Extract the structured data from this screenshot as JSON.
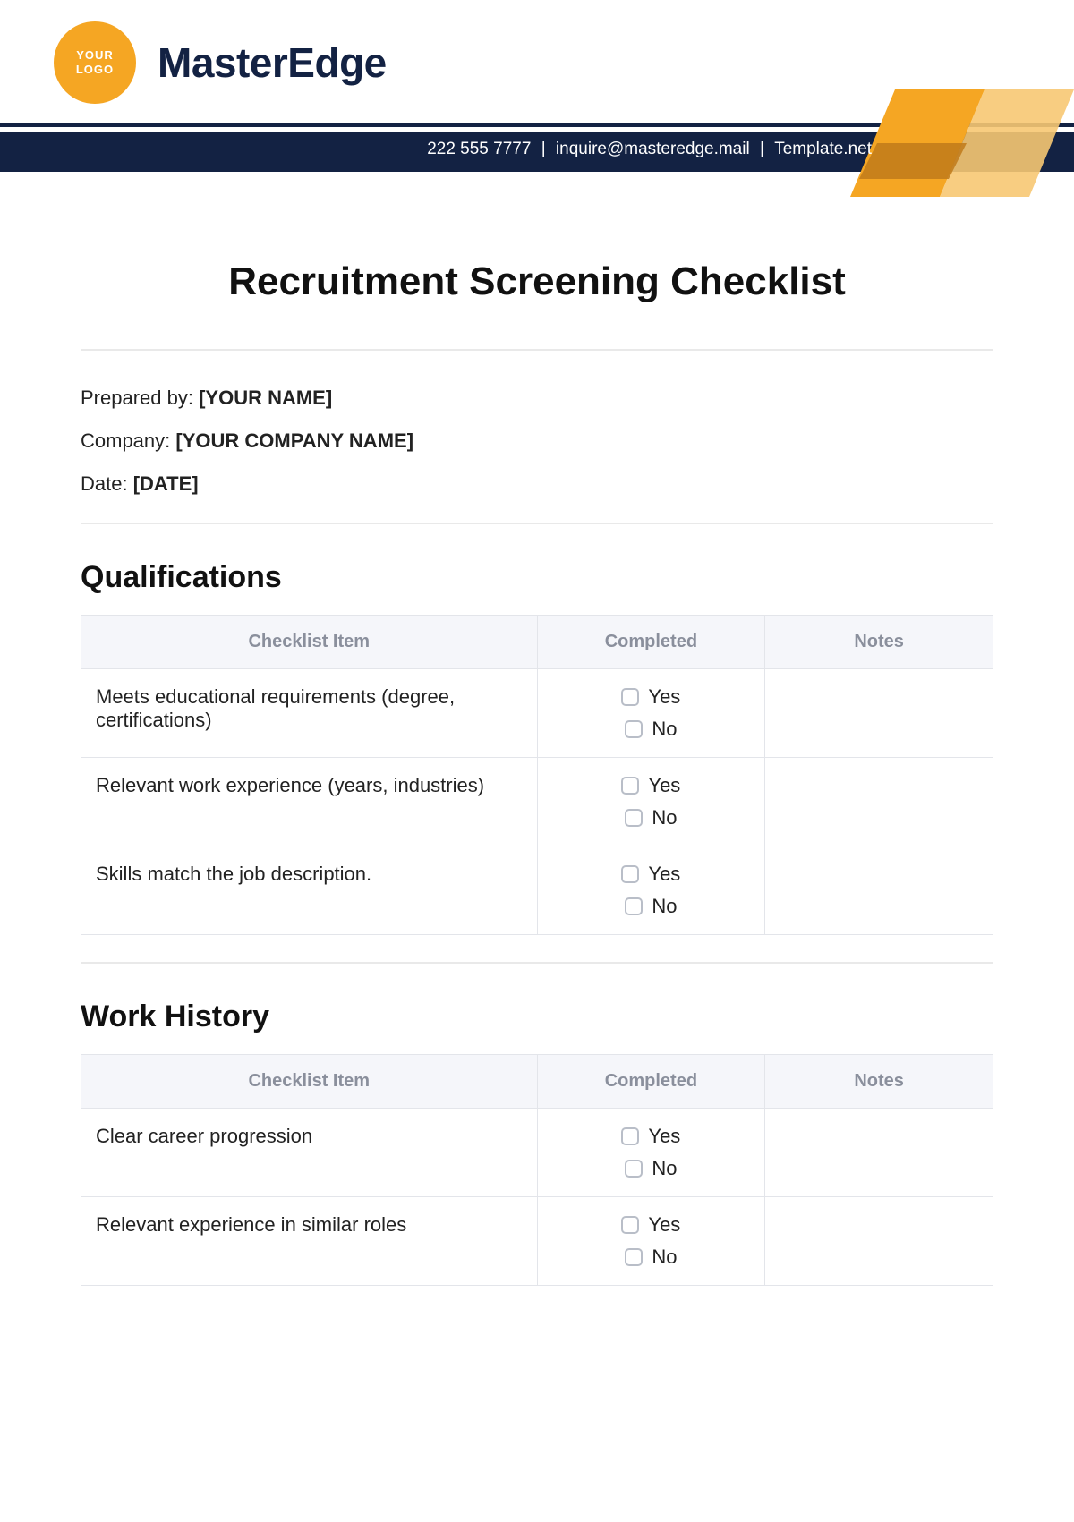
{
  "logo": {
    "line1": "YOUR",
    "line2": "LOGO"
  },
  "brand": "MasterEdge",
  "contact": {
    "phone": "222 555 7777",
    "email": "inquire@masteredge.mail",
    "site": "Template.net"
  },
  "title": "Recruitment Screening Checklist",
  "meta": {
    "prepared_label": "Prepared by: ",
    "prepared_value": "[YOUR NAME]",
    "company_label": "Company: ",
    "company_value": "[YOUR COMPANY NAME]",
    "date_label": "Date: ",
    "date_value": "[DATE]"
  },
  "table_headers": {
    "item": "Checklist Item",
    "completed": "Completed",
    "notes": "Notes"
  },
  "yn": {
    "yes": "Yes",
    "no": "No"
  },
  "sections": [
    {
      "title": "Qualifications",
      "rows": [
        {
          "item": "Meets educational requirements (degree, certifications)",
          "notes": ""
        },
        {
          "item": "Relevant work experience (years, industries)",
          "notes": ""
        },
        {
          "item": "Skills match the job description.",
          "notes": ""
        }
      ]
    },
    {
      "title": "Work History",
      "rows": [
        {
          "item": "Clear career progression",
          "notes": ""
        },
        {
          "item": "Relevant experience in similar roles",
          "notes": ""
        }
      ]
    }
  ]
}
